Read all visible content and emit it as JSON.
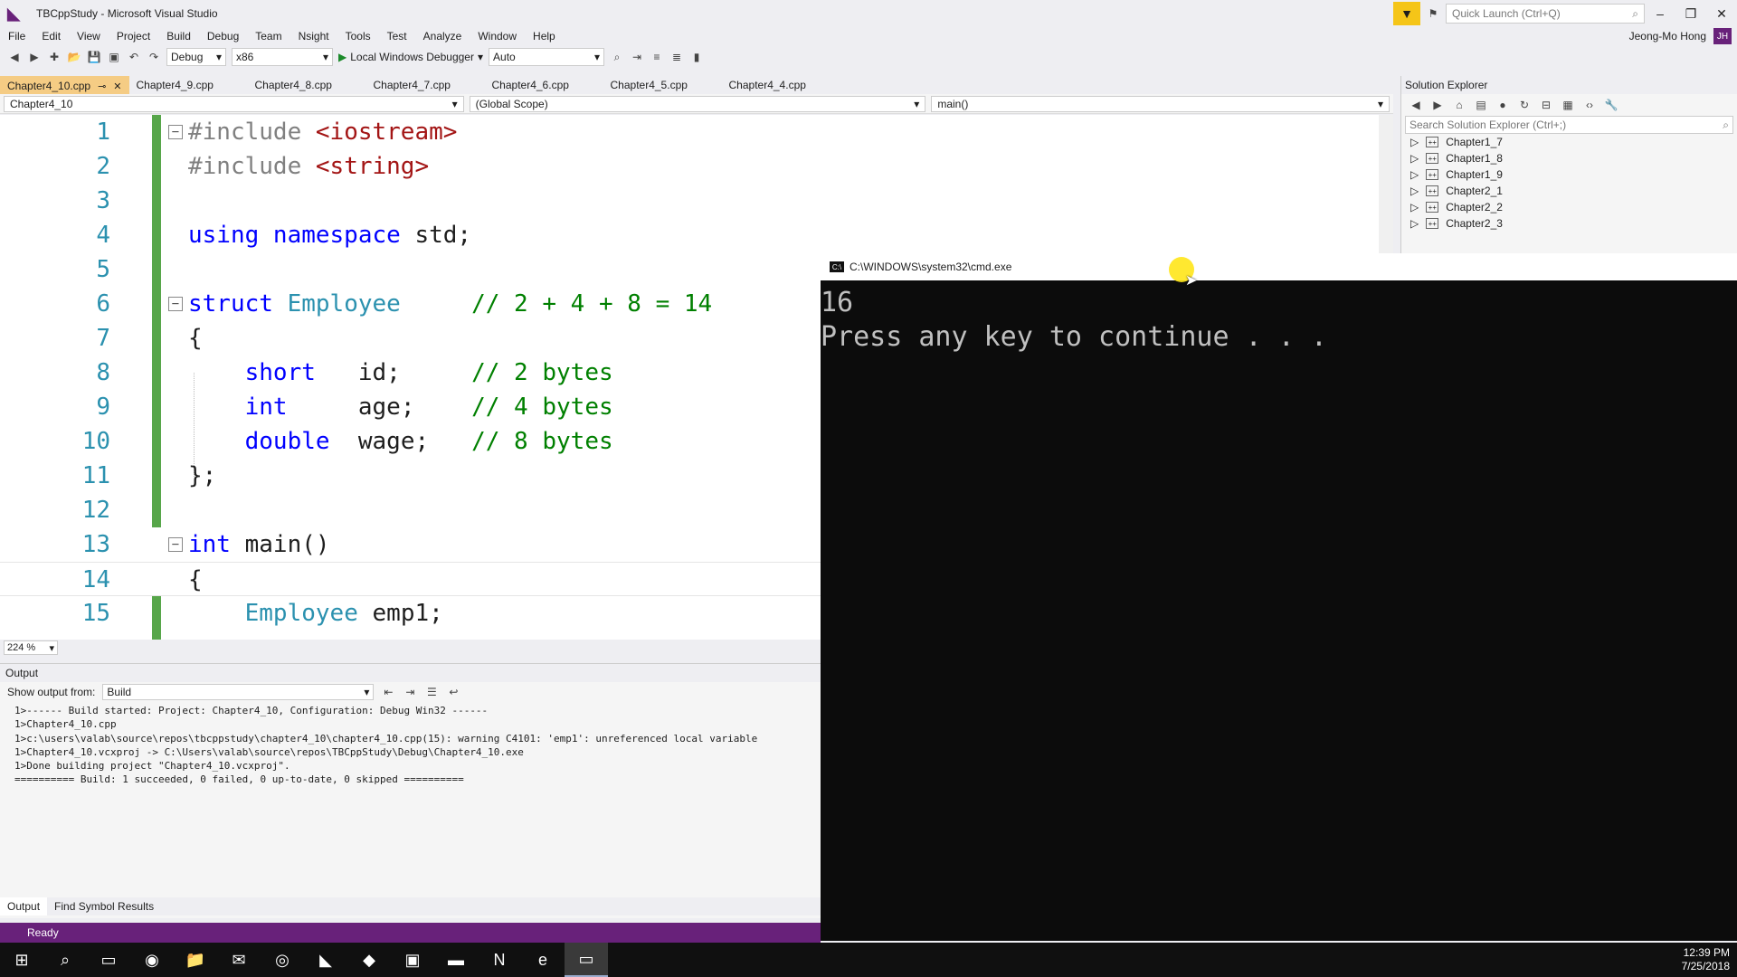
{
  "window": {
    "title": "TBCppStudy - Microsoft Visual Studio",
    "quick_launch_placeholder": "Quick Launch (Ctrl+Q)",
    "user_name": "Jeong-Mo Hong",
    "user_initials": "JH"
  },
  "menu": [
    "File",
    "Edit",
    "View",
    "Project",
    "Build",
    "Debug",
    "Team",
    "Nsight",
    "Tools",
    "Test",
    "Analyze",
    "Window",
    "Help"
  ],
  "toolbar": {
    "config": "Debug",
    "platform": "x86",
    "run_label": "Local Windows Debugger",
    "run_mode": "Auto"
  },
  "tabs": [
    "Chapter4_10.cpp",
    "Chapter4_9.cpp",
    "Chapter4_8.cpp",
    "Chapter4_7.cpp",
    "Chapter4_6.cpp",
    "Chapter4_5.cpp",
    "Chapter4_4.cpp"
  ],
  "nav": {
    "project": "Chapter4_10",
    "scope": "(Global Scope)",
    "member": "main()"
  },
  "code": {
    "line_numbers": [
      "1",
      "2",
      "3",
      "4",
      "5",
      "6",
      "7",
      "8",
      "9",
      "10",
      "11",
      "12",
      "13",
      "14",
      "15"
    ],
    "l1_pp": "#include",
    "l1_str": " <iostream>",
    "l2_pp": "#include",
    "l2_str": " <string>",
    "l4_kw": "using namespace",
    "l4_rest": " std;",
    "l6_kw": "struct",
    "l6_typ": " Employee",
    "l6_cm": "     // 2 + 4 + 8 = 14",
    "l7": "{",
    "l8_kw": "short",
    "l8_rest": "   id;     ",
    "l8_cm": "// 2 bytes",
    "l9_kw": "int",
    "l9_rest": "     age;    ",
    "l9_cm": "// 4 bytes",
    "l10_kw": "double",
    "l10_rest": "  wage;   ",
    "l10_cm": "// 8 bytes",
    "l11": "};",
    "l13_kw": "int",
    "l13_rest": " main()",
    "l14": "{",
    "l15_typ": "Employee",
    "l15_rest": " emp1;"
  },
  "zoom": "224 %",
  "output": {
    "title": "Output",
    "show_from_label": "Show output from:",
    "source": "Build",
    "lines": [
      "1>------ Build started: Project: Chapter4_10, Configuration: Debug Win32 ------",
      "1>Chapter4_10.cpp",
      "1>c:\\users\\valab\\source\\repos\\tbcppstudy\\chapter4_10\\chapter4_10.cpp(15): warning C4101: 'emp1': unreferenced local variable",
      "1>Chapter4_10.vcxproj -> C:\\Users\\valab\\source\\repos\\TBCppStudy\\Debug\\Chapter4_10.exe",
      "1>Done building project \"Chapter4_10.vcxproj\".",
      "========== Build: 1 succeeded, 0 failed, 0 up-to-date, 0 skipped =========="
    ]
  },
  "bottom_tabs": [
    "Output",
    "Find Symbol Results"
  ],
  "status": "Ready",
  "solution_explorer": {
    "title": "Solution Explorer",
    "search_placeholder": "Search Solution Explorer (Ctrl+;)",
    "items": [
      "Chapter1_7",
      "Chapter1_8",
      "Chapter1_9",
      "Chapter2_1",
      "Chapter2_2",
      "Chapter2_3"
    ]
  },
  "console": {
    "title": "C:\\WINDOWS\\system32\\cmd.exe",
    "output_value": "16",
    "prompt": "Press any key to continue . . ."
  },
  "clock": {
    "time": "12:39 PM",
    "date": "7/25/2018"
  },
  "colors": {
    "vs_purple": "#68217a",
    "active_tab": "#f5cc84",
    "keyword": "#0000ff",
    "type": "#2b91af",
    "comment": "#008000",
    "string": "#a31515"
  }
}
